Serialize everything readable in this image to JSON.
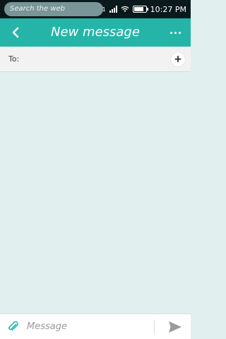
{
  "status_bar": {
    "search_placeholder": "Search the web",
    "network_label": "1",
    "time": "10:27 PM",
    "battery_level": 0.8
  },
  "header": {
    "title": "New message",
    "back_icon": "chevron-left-icon",
    "menu_icon": "more-horizontal-icon"
  },
  "recipient": {
    "label": "To:",
    "add_icon": "plus-icon"
  },
  "composer": {
    "placeholder": "Message",
    "attach_icon": "paperclip-icon",
    "send_icon": "send-icon"
  },
  "colors": {
    "header": "#24b5a8",
    "thread_background": "#e1f0ee",
    "status_bar": "#0a1a1c"
  }
}
